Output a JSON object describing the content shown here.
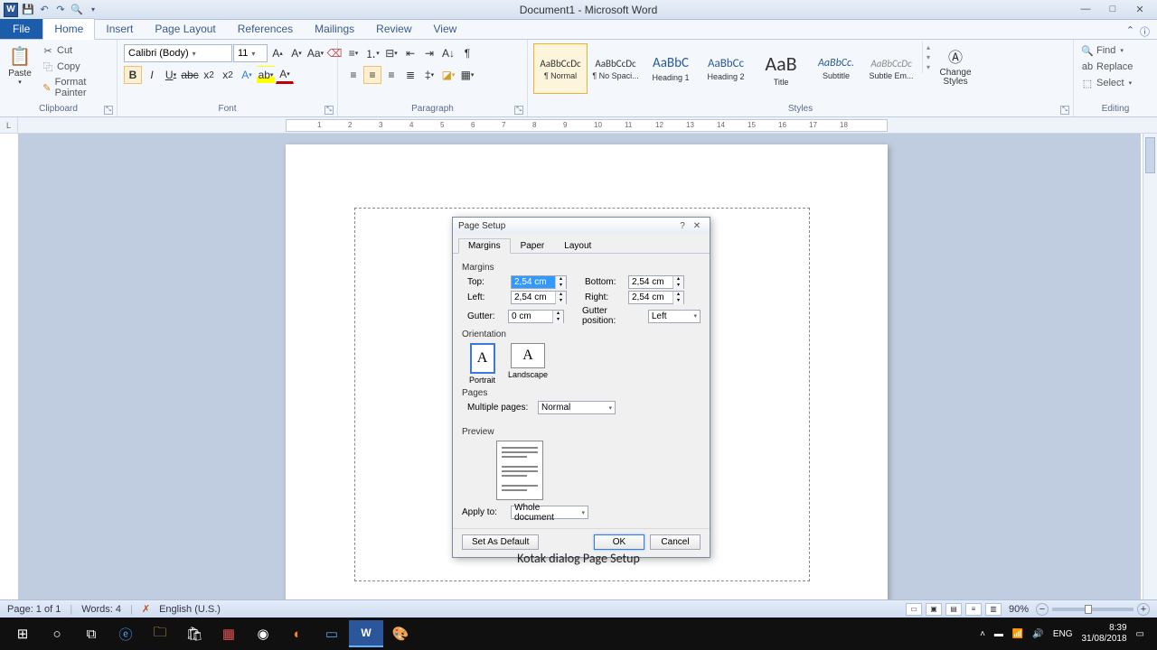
{
  "titlebar": {
    "title": "Document1 - Microsoft Word"
  },
  "tabs": {
    "file": "File",
    "home": "Home",
    "insert": "Insert",
    "pagelayout": "Page Layout",
    "references": "References",
    "mailings": "Mailings",
    "review": "Review",
    "view": "View"
  },
  "clipboard": {
    "label": "Clipboard",
    "paste": "Paste",
    "cut": "Cut",
    "copy": "Copy",
    "fmt": "Format Painter"
  },
  "font": {
    "label": "Font",
    "family": "Calibri (Body)",
    "size": "11"
  },
  "paragraph": {
    "label": "Paragraph"
  },
  "styles": {
    "label": "Styles",
    "items": [
      {
        "preview": "AaBbCcDc",
        "name": "¶ Normal",
        "size": "11px",
        "color": "#333"
      },
      {
        "preview": "AaBbCcDc",
        "name": "¶ No Spaci...",
        "size": "11px",
        "color": "#333"
      },
      {
        "preview": "AaBbC",
        "name": "Heading 1",
        "size": "15px",
        "color": "#2a5a9a"
      },
      {
        "preview": "AaBbCc",
        "name": "Heading 2",
        "size": "13px",
        "color": "#2a5a9a"
      },
      {
        "preview": "AaB",
        "name": "Title",
        "size": "22px",
        "color": "#333"
      },
      {
        "preview": "AaBbCc.",
        "name": "Subtitle",
        "size": "12px",
        "color": "#2a5a9a",
        "italic": true
      },
      {
        "preview": "AaBbCcDc",
        "name": "Subtle Em...",
        "size": "11px",
        "color": "#888",
        "italic": true
      }
    ],
    "change": "Change Styles"
  },
  "editing": {
    "label": "Editing",
    "find": "Find",
    "replace": "Replace",
    "select": "Select"
  },
  "dialog": {
    "title": "Page Setup",
    "tabs": {
      "margins": "Margins",
      "paper": "Paper",
      "layout": "Layout"
    },
    "margins_section": "Margins",
    "top_lbl": "Top:",
    "top": "2,54 cm",
    "bottom_lbl": "Bottom:",
    "bottom": "2,54 cm",
    "left_lbl": "Left:",
    "left": "2,54 cm",
    "right_lbl": "Right:",
    "right": "2,54 cm",
    "gutter_lbl": "Gutter:",
    "gutter": "0 cm",
    "gutterpos_lbl": "Gutter position:",
    "gutterpos": "Left",
    "orientation_section": "Orientation",
    "portrait": "Portrait",
    "landscape": "Landscape",
    "pages_section": "Pages",
    "multpages_lbl": "Multiple pages:",
    "multpages": "Normal",
    "preview_section": "Preview",
    "applyto_lbl": "Apply to:",
    "applyto": "Whole document",
    "setdefault": "Set As Default",
    "ok": "OK",
    "cancel": "Cancel"
  },
  "caption": "Kotak dialog Page Setup",
  "status": {
    "page": "Page: 1 of 1",
    "words": "Words: 4",
    "lang": "English (U.S.)",
    "zoom": "90%"
  },
  "tray": {
    "lang": "ENG",
    "time": "8:39",
    "date": "31/08/2018"
  }
}
